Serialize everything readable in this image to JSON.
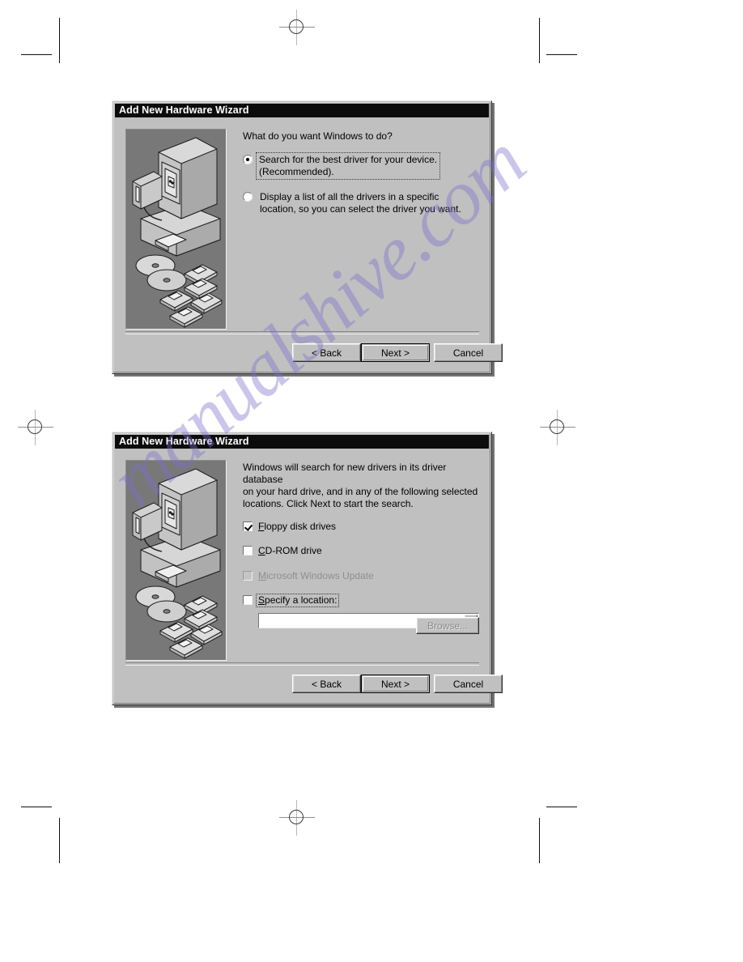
{
  "page": {
    "watermark": "manualshive.com",
    "background": "#ffffff"
  },
  "colors": {
    "dialog_face": "#c0c0c0",
    "titlebar": "#0c0c0c",
    "titlebar_text": "#ffffff",
    "graphic_panel": "#787878",
    "disabled_text": "#8c8c8c",
    "watermark": "#7b6ecb"
  },
  "dialog1": {
    "title": "Add New Hardware Wizard",
    "graphic_name": "computer-with-disks-illustration",
    "prompt": "What do you want Windows to do?",
    "options": [
      {
        "id": "search-best-driver",
        "line1": "Search for the best driver for your device.",
        "line2": "(Recommended).",
        "checked": true,
        "focused": true
      },
      {
        "id": "display-list-drivers",
        "line1": "Display a list of all the drivers in a specific",
        "line2": "location, so you can select the driver you want.",
        "checked": false,
        "focused": false
      }
    ],
    "buttons": {
      "back": "< Back",
      "next": "Next >",
      "cancel": "Cancel"
    }
  },
  "dialog2": {
    "title": "Add New Hardware Wizard",
    "graphic_name": "computer-with-disks-illustration",
    "prompt_line1": "Windows will search for new drivers in its driver database",
    "prompt_line2": "on your hard drive, and in any of the following selected",
    "prompt_line3": "locations. Click Next to start the search.",
    "checkboxes": [
      {
        "id": "floppy-disk-drives",
        "label": "Floppy disk drives",
        "accel": "F",
        "checked": true,
        "disabled": false,
        "focused": false
      },
      {
        "id": "cd-rom-drive",
        "label": "CD-ROM drive",
        "accel": "C",
        "checked": false,
        "disabled": false,
        "focused": false
      },
      {
        "id": "microsoft-windows-update",
        "label": "Microsoft Windows Update",
        "accel": "M",
        "checked": false,
        "disabled": true,
        "focused": false
      },
      {
        "id": "specify-a-location",
        "label": "Specify a location:",
        "accel": "S",
        "checked": false,
        "disabled": false,
        "focused": true
      }
    ],
    "location_combo": {
      "value": "",
      "placeholder": ""
    },
    "browse_button": {
      "label": "Browse...",
      "disabled": true
    },
    "buttons": {
      "back": "< Back",
      "next": "Next >",
      "cancel": "Cancel"
    }
  }
}
